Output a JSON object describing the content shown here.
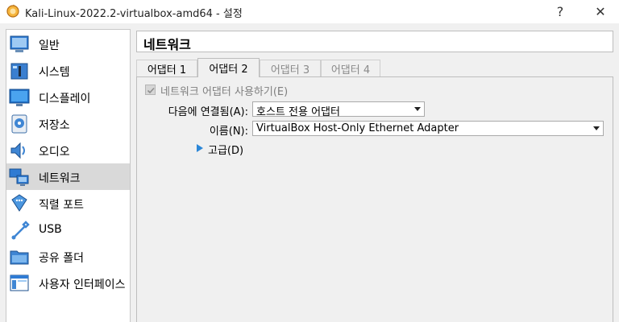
{
  "window": {
    "title": "Kali-Linux-2022.2-virtualbox-amd64 - 설정",
    "help_glyph": "?",
    "close_glyph": "✕"
  },
  "sidebar": {
    "items": [
      {
        "label": "일반",
        "icon": "general-icon"
      },
      {
        "label": "시스템",
        "icon": "system-icon"
      },
      {
        "label": "디스플레이",
        "icon": "display-icon"
      },
      {
        "label": "저장소",
        "icon": "storage-icon"
      },
      {
        "label": "오디오",
        "icon": "audio-icon"
      },
      {
        "label": "네트워크",
        "icon": "network-icon",
        "selected": true
      },
      {
        "label": "직렬 포트",
        "icon": "serial-port-icon"
      },
      {
        "label": "USB",
        "icon": "usb-icon"
      },
      {
        "label": "공유 폴더",
        "icon": "shared-folder-icon"
      },
      {
        "label": "사용자 인터페이스",
        "icon": "user-interface-icon"
      }
    ]
  },
  "page": {
    "title": "네트워크"
  },
  "tabs": [
    {
      "label": "어댑터 1",
      "state": "normal"
    },
    {
      "label": "어댑터 2",
      "state": "active"
    },
    {
      "label": "어댑터 3",
      "state": "disabled"
    },
    {
      "label": "어댑터 4",
      "state": "disabled"
    }
  ],
  "adapter": {
    "enable_label": "네트워크 어댑터 사용하기(E)",
    "enable_checked": true,
    "attached_label": "다음에 연결됨(A):",
    "attached_value": "호스트 전용 어댑터",
    "name_label": "이름(N):",
    "name_value": "VirtualBox Host-Only Ethernet Adapter",
    "advanced_label": "고급(D)"
  },
  "colors": {
    "selected_bg": "#d9d9d9",
    "accent": "#2b87d8"
  }
}
